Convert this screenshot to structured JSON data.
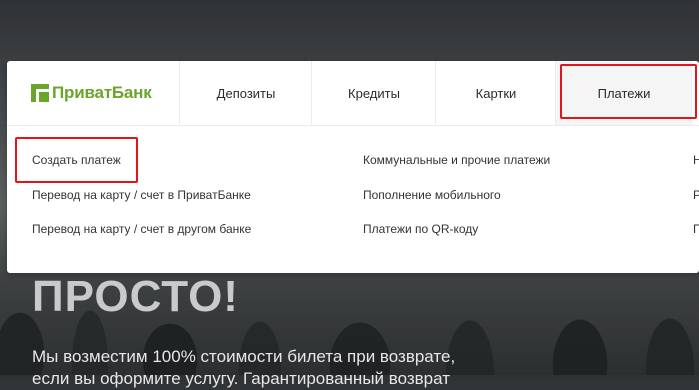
{
  "brand": {
    "name": "ПриватБанк",
    "color": "#6aa52c",
    "icon": "privatbank-logo-icon"
  },
  "nav": {
    "tabs": [
      {
        "label": "Депозиты"
      },
      {
        "label": "Кредиты"
      },
      {
        "label": "Картки"
      },
      {
        "label": "Платежи",
        "active": true
      }
    ]
  },
  "submenu": {
    "col1": [
      "Создать платеж",
      "Перевод на карту / счет в ПриватБанке",
      "Перевод на карту / счет в другом банке"
    ],
    "col2": [
      "Коммунальные и прочие платежи",
      "Пополнение мобильного",
      "Платежи по QR-коду"
    ],
    "col3": [
      "Н",
      "Р",
      "П"
    ]
  },
  "hero": {
    "title": "ПРОСТО!",
    "text": "Мы возместим 100% стоимости билета при возврате, если вы оформите услугу. Гарантированный возврат"
  },
  "highlight_color": "#e3141b"
}
